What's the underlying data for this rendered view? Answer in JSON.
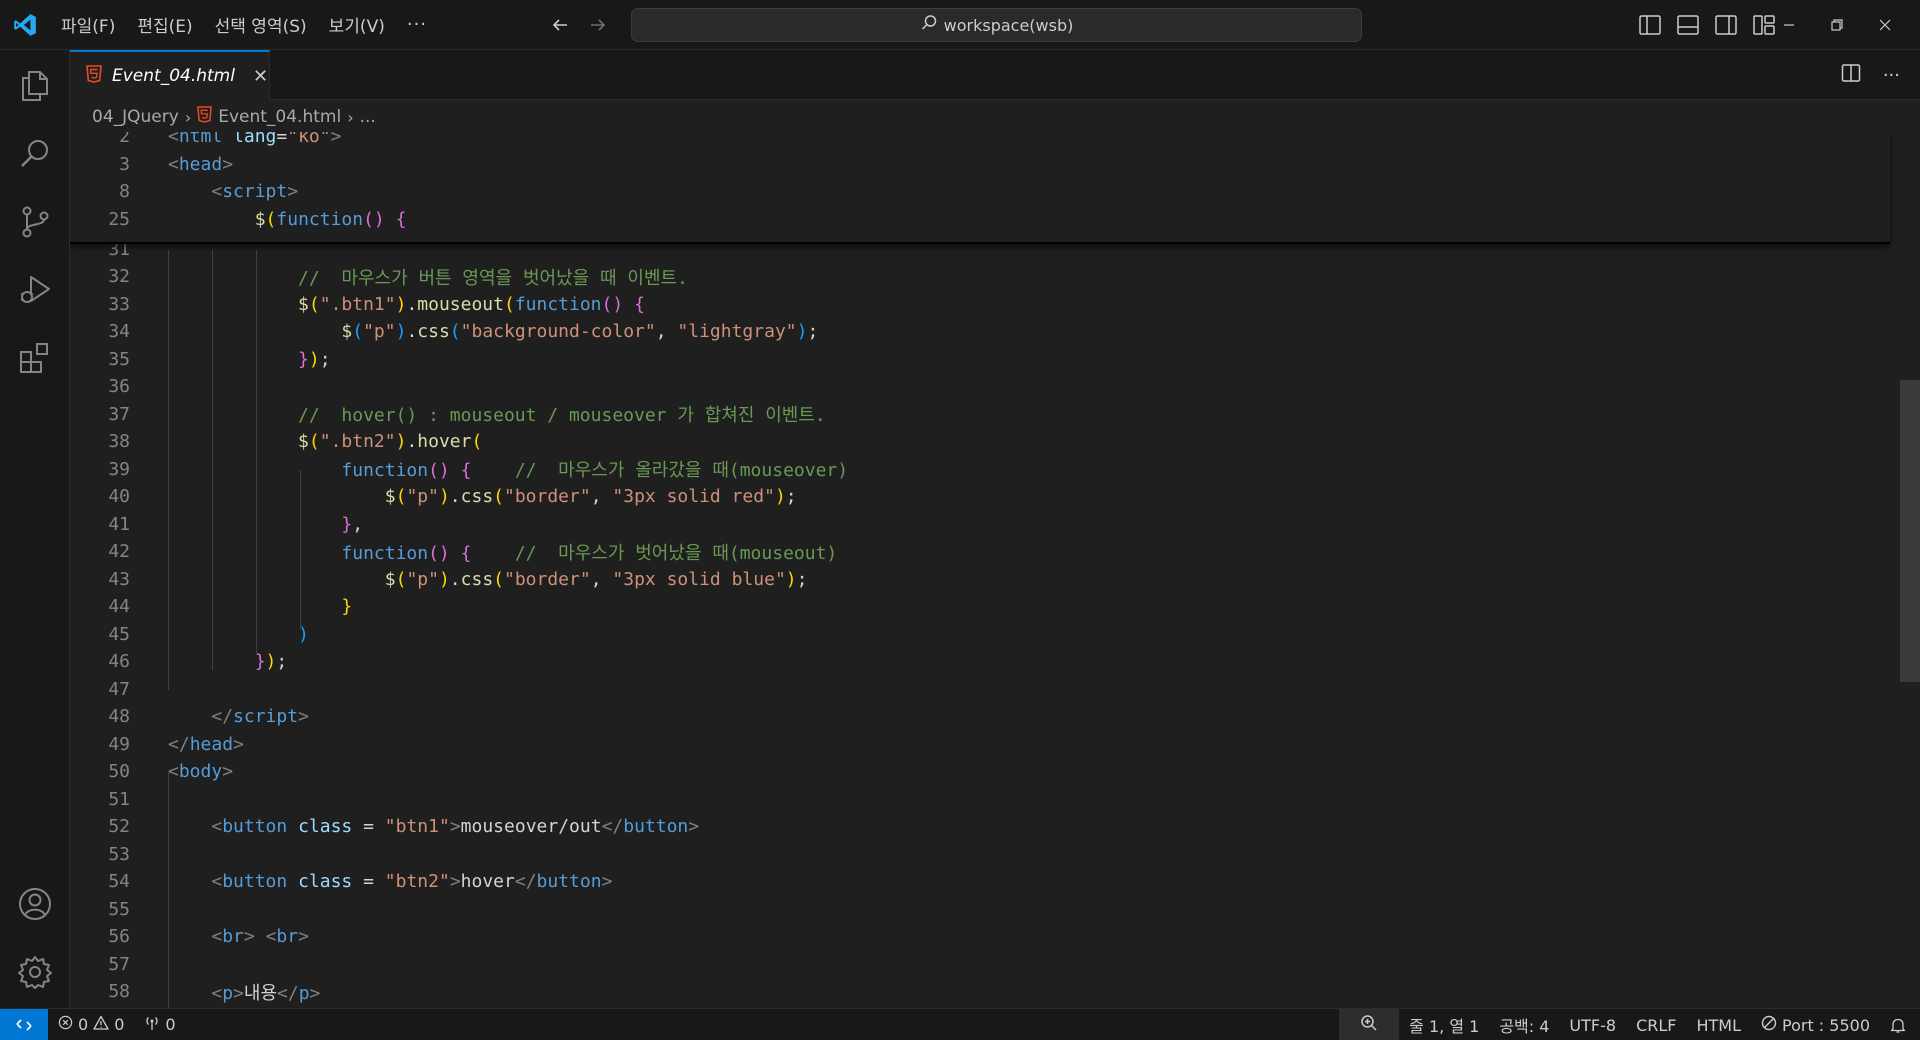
{
  "titlebar": {
    "menu": [
      "파일(F)",
      "편집(E)",
      "선택 영역(S)",
      "보기(V)"
    ],
    "more": "···",
    "search_text": "workspace(wsb)"
  },
  "tab": {
    "label": "Event_04.html",
    "close": "✕"
  },
  "tab_actions": {
    "more": "···"
  },
  "breadcrumb": {
    "folder": "04_JQuery",
    "file": "Event_04.html",
    "more": "..."
  },
  "sticky": [
    {
      "ln": "2",
      "html": "<span class='t-br'>&lt;</span><span class='t-tag'>html</span> <span class='t-attr'>lang</span><span class='t-txt'>=</span><span class='t-str'>\"ko\"</span><span class='t-br'>&gt;</span>"
    },
    {
      "ln": "3",
      "html": "<span class='t-br'>&lt;</span><span class='t-tag'>head</span><span class='t-br'>&gt;</span>"
    },
    {
      "ln": "8",
      "html": "    <span class='t-br'>&lt;</span><span class='t-tag'>script</span><span class='t-br'>&gt;</span>"
    },
    {
      "ln": "25",
      "html": "        <span class='t-fn'>$</span><span class='t-p1'>(</span><span class='t-kw'>function</span><span class='t-p2'>()</span> <span class='t-p2'>{</span>"
    }
  ],
  "lines": [
    {
      "ln": "31",
      "html": ""
    },
    {
      "ln": "32",
      "html": "            <span class='t-cm'>//  마우스가 버튼 영역을 벗어났을 때 이벤트.</span>"
    },
    {
      "ln": "33",
      "html": "            <span class='t-fn'>$</span><span class='t-p1'>(</span><span class='t-str'>\".btn1\"</span><span class='t-p1'>)</span><span class='t-txt'>.</span><span class='t-fn'>mouseout</span><span class='t-p1'>(</span><span class='t-kw'>function</span><span class='t-p2'>()</span> <span class='t-p2'>{</span>"
    },
    {
      "ln": "34",
      "html": "                <span class='t-fn'>$</span><span class='t-p3'>(</span><span class='t-str'>\"p\"</span><span class='t-p3'>)</span><span class='t-txt'>.</span><span class='t-fn'>css</span><span class='t-p3'>(</span><span class='t-str'>\"background-color\"</span><span class='t-txt'>, </span><span class='t-str'>\"lightgray\"</span><span class='t-p3'>)</span><span class='t-txt'>;</span>"
    },
    {
      "ln": "35",
      "html": "            <span class='t-p2'>}</span><span class='t-p1'>)</span><span class='t-txt'>;</span>"
    },
    {
      "ln": "36",
      "html": ""
    },
    {
      "ln": "37",
      "html": "            <span class='t-cm'>//  hover() : mouseout / mouseover 가 합쳐진 이벤트.</span>"
    },
    {
      "ln": "38",
      "html": "            <span class='t-fn'>$</span><span class='t-p1'>(</span><span class='t-str'>\".btn2\"</span><span class='t-p1'>)</span><span class='t-txt'>.</span><span class='t-fn'>hover</span><span class='t-p1'>(</span>"
    },
    {
      "ln": "39",
      "html": "                <span class='t-kw'>function</span><span class='t-p2'>()</span> <span class='t-p2'>{</span>    <span class='t-cm'>//  마우스가 올라갔을 때(mouseover)</span>"
    },
    {
      "ln": "40",
      "html": "                    <span class='t-fn'>$</span><span class='t-p1'>(</span><span class='t-str'>\"p\"</span><span class='t-p1'>)</span><span class='t-txt'>.</span><span class='t-fn'>css</span><span class='t-p1'>(</span><span class='t-str'>\"border\"</span><span class='t-txt'>, </span><span class='t-str'>\"3px solid red\"</span><span class='t-p1'>)</span><span class='t-txt'>;</span>"
    },
    {
      "ln": "41",
      "html": "                <span class='t-p2'>}</span><span class='t-txt'>,</span>"
    },
    {
      "ln": "42",
      "html": "                <span class='t-kw'>function</span><span class='t-p2'>()</span> <span class='t-p2'>{</span>    <span class='t-cm'>//  마우스가 벗어났을 때(mouseout)</span>"
    },
    {
      "ln": "43",
      "html": "                    <span class='t-fn'>$</span><span class='t-p1'>(</span><span class='t-str'>\"p\"</span><span class='t-p1'>)</span><span class='t-txt'>.</span><span class='t-fn'>css</span><span class='t-p1'>(</span><span class='t-str'>\"border\"</span><span class='t-txt'>, </span><span class='t-str'>\"3px solid blue\"</span><span class='t-p1'>)</span><span class='t-txt'>;</span>"
    },
    {
      "ln": "44",
      "html": "                <span class='t-p1'>}</span>"
    },
    {
      "ln": "45",
      "html": "            <span class='t-p3'>)</span>"
    },
    {
      "ln": "46",
      "html": "        <span class='t-p2'>}</span><span class='t-p1'>)</span><span class='t-txt'>;</span>"
    },
    {
      "ln": "47",
      "html": ""
    },
    {
      "ln": "48",
      "html": "    <span class='t-br'>&lt;/</span><span class='t-tag'>script</span><span class='t-br'>&gt;</span>"
    },
    {
      "ln": "49",
      "html": "<span class='t-br'>&lt;/</span><span class='t-tag'>head</span><span class='t-br'>&gt;</span>"
    },
    {
      "ln": "50",
      "html": "<span class='t-br'>&lt;</span><span class='t-tag'>body</span><span class='t-br'>&gt;</span>"
    },
    {
      "ln": "51",
      "html": ""
    },
    {
      "ln": "52",
      "html": "    <span class='t-br'>&lt;</span><span class='t-tag'>button</span> <span class='t-attr'>class</span> <span class='t-txt'>=</span> <span class='t-str'>\"btn1\"</span><span class='t-br'>&gt;</span><span class='t-txt'>mouseover/out</span><span class='t-br'>&lt;/</span><span class='t-tag'>button</span><span class='t-br'>&gt;</span>"
    },
    {
      "ln": "53",
      "html": ""
    },
    {
      "ln": "54",
      "html": "    <span class='t-br'>&lt;</span><span class='t-tag'>button</span> <span class='t-attr'>class</span> <span class='t-txt'>=</span> <span class='t-str'>\"btn2\"</span><span class='t-br'>&gt;</span><span class='t-txt'>hover</span><span class='t-br'>&lt;/</span><span class='t-tag'>button</span><span class='t-br'>&gt;</span>"
    },
    {
      "ln": "55",
      "html": ""
    },
    {
      "ln": "56",
      "html": "    <span class='t-br'>&lt;</span><span class='t-tag'>br</span><span class='t-br'>&gt;</span> <span class='t-br'>&lt;</span><span class='t-tag'>br</span><span class='t-br'>&gt;</span>"
    },
    {
      "ln": "57",
      "html": ""
    },
    {
      "ln": "58",
      "html": "    <span class='t-br'>&lt;</span><span class='t-tag'>p</span><span class='t-br'>&gt;</span><span class='t-txt'>내용</span><span class='t-br'>&lt;/</span><span class='t-tag'>p</span><span class='t-br'>&gt;</span>"
    }
  ],
  "statusbar": {
    "errors": "0",
    "warnings": "0",
    "ports_fwd": "0",
    "cursor": "줄 1, 열 1",
    "spaces": "공백: 4",
    "encoding": "UTF-8",
    "eol": "CRLF",
    "language": "HTML",
    "port": "Port : 5500"
  },
  "colors": {
    "accent": "#0078d4",
    "background": "#1f1f1f",
    "chrome": "#181818"
  }
}
